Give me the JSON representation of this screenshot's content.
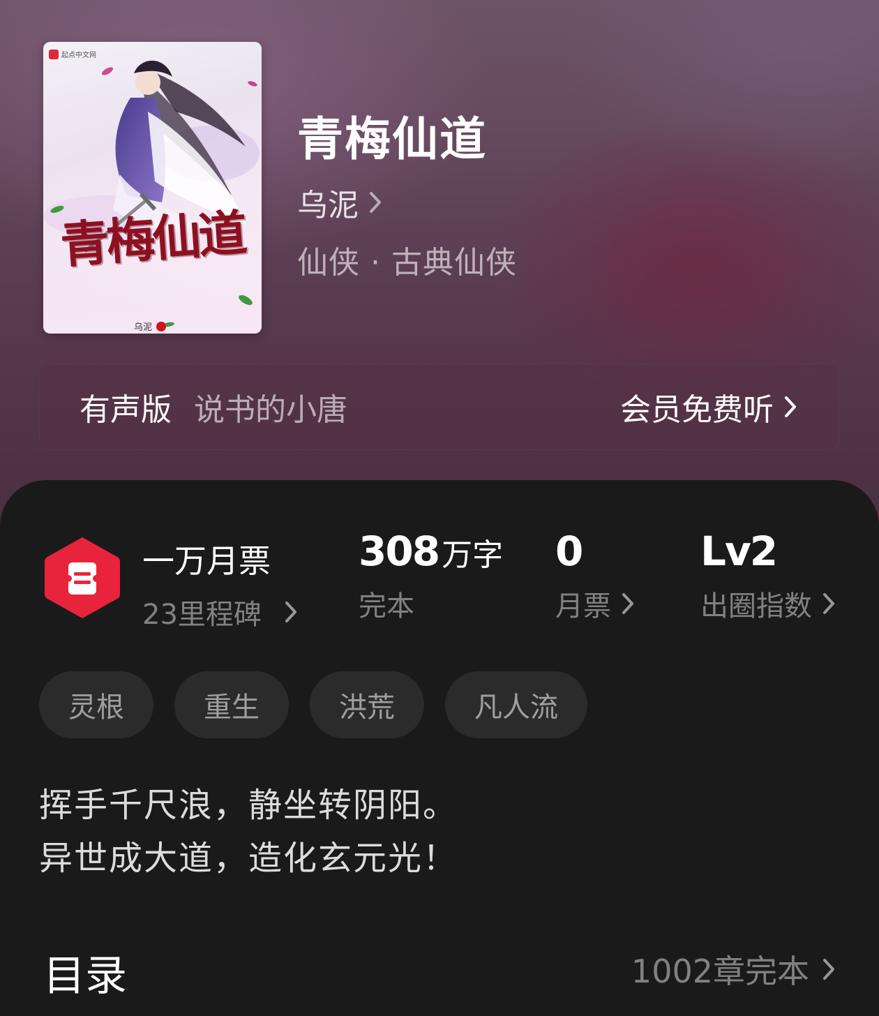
{
  "book": {
    "title": "青梅仙道",
    "author": "乌泥",
    "genre": "仙侠 · 古典仙侠"
  },
  "cover": {
    "publisher": "起点中文网",
    "title": "青梅仙道",
    "author": "乌泥"
  },
  "audio": {
    "label": "有声版",
    "narrator": "说书的小唐",
    "cta": "会员免费听"
  },
  "stats": {
    "ticket": {
      "title": "一万月票",
      "sub": "23里程碑"
    },
    "words": {
      "value": "308",
      "unit": "万字",
      "sub": "完本"
    },
    "monthly": {
      "value": "0",
      "sub": "月票"
    },
    "level": {
      "value": "Lv2",
      "sub": "出圈指数"
    }
  },
  "tags": [
    "灵根",
    "重生",
    "洪荒",
    "凡人流"
  ],
  "intro": {
    "line1": "挥手千尺浪，静坐转阴阳。",
    "line2": "异世成大道，造化玄元光！"
  },
  "toc": {
    "title": "目录",
    "count": "1002章完本"
  },
  "colors": {
    "accent": "#e8243c",
    "panel": "#1a1a1b",
    "tag_bg": "#2b2b2c"
  }
}
